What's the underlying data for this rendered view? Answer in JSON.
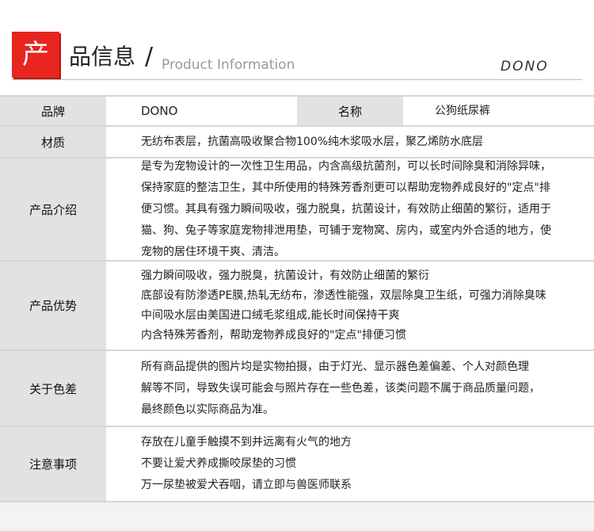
{
  "header": {
    "logo_char": "产",
    "title": "品信息",
    "slash": "/",
    "subtitle": "Product Information",
    "brand": "DONO"
  },
  "rows": [
    {
      "label": "品牌",
      "value": "DONO",
      "label2": "名称",
      "value2": "公狗纸尿裤"
    },
    {
      "label": "材质",
      "lines": [
        "无纺布表层，抗菌高吸收聚合物100%纯木浆吸水层，聚乙烯防水底层"
      ]
    },
    {
      "label": "产品介绍",
      "lines": [
        "是专为宠物设计的一次性卫生用品，内含高级抗菌剂，可以长时间除臭和消除异味，",
        "保持家庭的整洁卫生，其中所使用的特殊芳香剂更可以帮助宠物养成良好的\"定点\"排",
        "便习惯。其具有强力瞬间吸收，强力脱臭，抗菌设计，有效防止细菌的繁衍，适用于",
        "猫、狗、兔子等家庭宠物排泄用垫，可铺于宠物窝、房内，或室内外合适的地方，使",
        "宠物的居住环境干爽、清洁。"
      ]
    },
    {
      "label": "产品优势",
      "lines": [
        "强力瞬间吸收，强力脱臭，抗菌设计，有效防止细菌的繁衍",
        "底部设有防渗透PE膜,热轧无纺布，渗透性能强，双层除臭卫生纸，可强力消除臭味",
        "中间吸水层由美国进口绒毛浆组成,能长时间保持干爽",
        "内含特殊芳香剂，帮助宠物养成良好的\"定点\"排便习惯"
      ]
    },
    {
      "label": "关于色差",
      "lines": [
        "所有商品提供的图片均是实物拍摄，由于灯光、显示器色差偏差、个人对颜色理",
        "解等不同，导致失误可能会与照片存在一些色差，该类问题不属于商品质量问题，",
        "最终颜色以实际商品为准。"
      ]
    },
    {
      "label": "注意事项",
      "lines": [
        "存放在儿童手触摸不到并远离有火气的地方",
        "不要让爱犬养成撕咬尿垫的习惯",
        "万一尿垫被爱犬吞咽，请立即与兽医师联系"
      ]
    }
  ]
}
